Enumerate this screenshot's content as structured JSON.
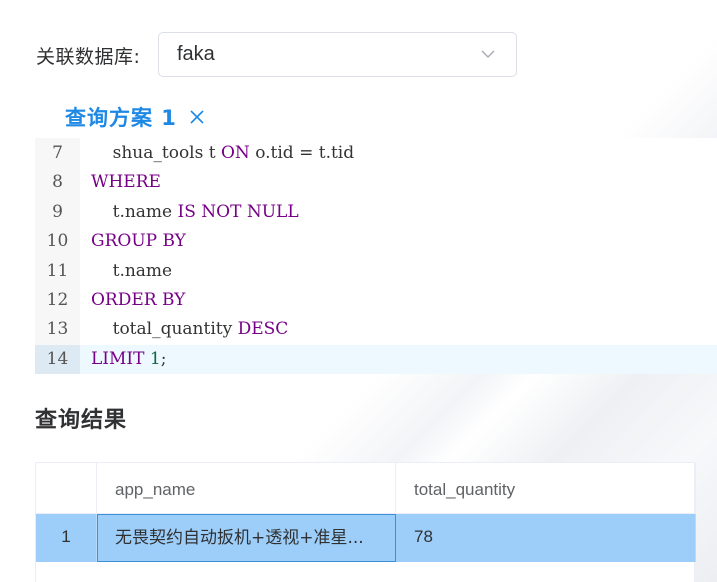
{
  "database": {
    "label": "关联数据库:",
    "selected": "faka"
  },
  "tabs": [
    {
      "label": "查询方案 1",
      "close_icon": "close-icon"
    }
  ],
  "editor": {
    "lines": [
      {
        "number": "7",
        "tokens": [
          {
            "t": "    shua_tools t ",
            "c": ""
          },
          {
            "t": "ON",
            "c": "kw"
          },
          {
            "t": " o.tid = t.tid",
            "c": ""
          }
        ]
      },
      {
        "number": "8",
        "tokens": [
          {
            "t": "WHERE",
            "c": "kw"
          }
        ]
      },
      {
        "number": "9",
        "tokens": [
          {
            "t": "    t.name ",
            "c": ""
          },
          {
            "t": "IS NOT NULL",
            "c": "kw"
          }
        ]
      },
      {
        "number": "10",
        "tokens": [
          {
            "t": "GROUP BY",
            "c": "kw"
          }
        ]
      },
      {
        "number": "11",
        "tokens": [
          {
            "t": "    t.name",
            "c": ""
          }
        ]
      },
      {
        "number": "12",
        "tokens": [
          {
            "t": "ORDER BY",
            "c": "kw"
          }
        ]
      },
      {
        "number": "13",
        "tokens": [
          {
            "t": "    total_quantity ",
            "c": ""
          },
          {
            "t": "DESC",
            "c": "kw"
          }
        ]
      },
      {
        "number": "14",
        "active": true,
        "tokens": [
          {
            "t": "LIMIT",
            "c": "kw"
          },
          {
            "t": " ",
            "c": ""
          },
          {
            "t": "1",
            "c": "num"
          },
          {
            "t": ";",
            "c": ""
          }
        ]
      }
    ]
  },
  "results": {
    "title": "查询结果",
    "columns": [
      "",
      "app_name",
      "total_quantity"
    ],
    "rows": [
      {
        "index": "1",
        "app_name": "无畏契约自动扳机+透视+准星...",
        "total_quantity": "78"
      }
    ]
  },
  "colors": {
    "accent": "#1e88e5",
    "keyword": "#770088",
    "number": "#116644",
    "selected_row": "#9ccef9"
  }
}
